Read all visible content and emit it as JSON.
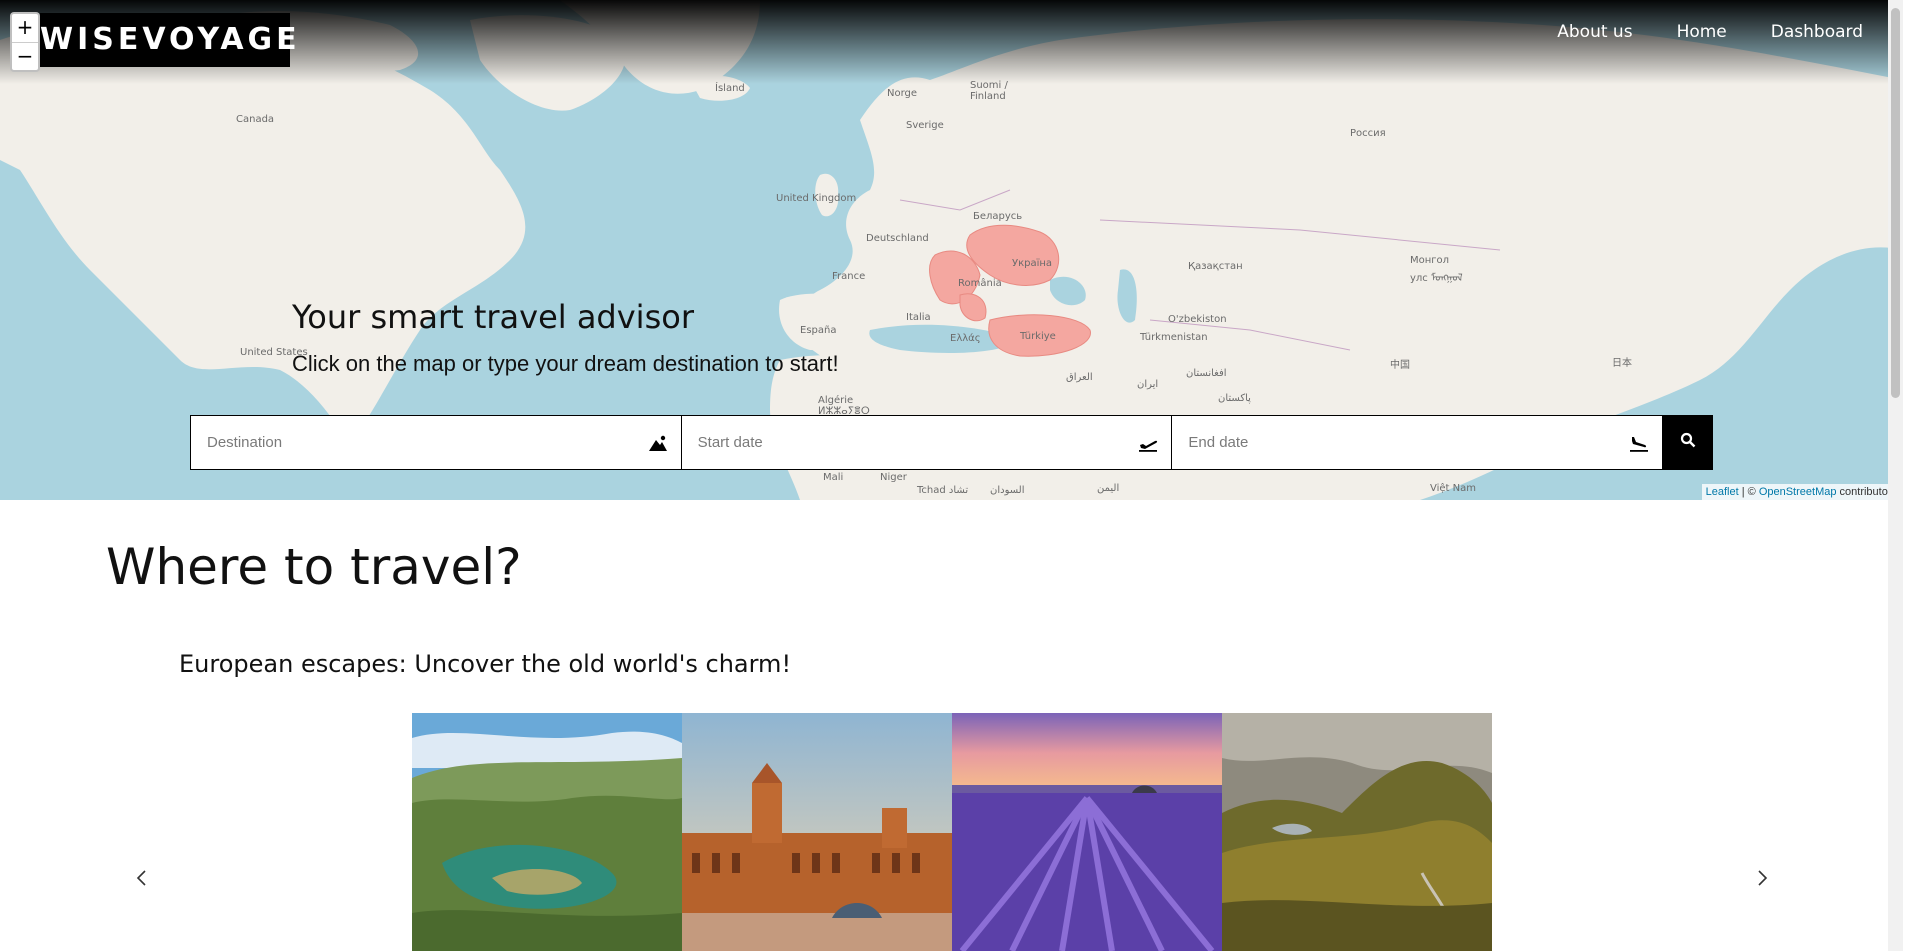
{
  "brand": {
    "logo_text": "WISEVOYAGE"
  },
  "nav": {
    "items": [
      "About us",
      "Home",
      "Dashboard"
    ]
  },
  "map": {
    "zoom_in": "+",
    "zoom_out": "−",
    "highlight_color": "#f4a7a0",
    "labels": [
      {
        "text": "Ísland"
      },
      {
        "text": "Norge"
      },
      {
        "text": "Suomi / Finland"
      },
      {
        "text": "Sverige"
      },
      {
        "text": "Canada"
      },
      {
        "text": "Россия"
      },
      {
        "text": "United Kingdom"
      },
      {
        "text": "Беларусь"
      },
      {
        "text": "Deutschland"
      },
      {
        "text": "Україна"
      },
      {
        "text": "România"
      },
      {
        "text": "France"
      },
      {
        "text": "Italia"
      },
      {
        "text": "España"
      },
      {
        "text": "Ελλάς"
      },
      {
        "text": "Türkiye"
      },
      {
        "text": "Қазақстан"
      },
      {
        "text": "Монгол улс ᠮᠣᠩᠭᠣᠯ"
      },
      {
        "text": "O'zbekiston"
      },
      {
        "text": "Türkmenistan"
      },
      {
        "text": "United States"
      },
      {
        "text": "Algérie ⵍⵣⵣⴰⵢⴻⵔ"
      },
      {
        "text": "العراق"
      },
      {
        "text": "ایران"
      },
      {
        "text": "افغانستان"
      },
      {
        "text": "پاکستان"
      },
      {
        "text": "中国"
      },
      {
        "text": "日本"
      },
      {
        "text": "Mali"
      },
      {
        "text": "Niger"
      },
      {
        "text": "Tchad تشاد"
      },
      {
        "text": "السودان"
      },
      {
        "text": "اليمن"
      },
      {
        "text": "Việt Nam"
      }
    ],
    "attribution": {
      "leaflet": "Leaflet",
      "sep": " | © ",
      "osm": "OpenStreetMap",
      "suffix": " contributors"
    }
  },
  "hero": {
    "title": "Your smart travel advisor",
    "subtitle": "Click on the map or type your dream destination to start!"
  },
  "search": {
    "destination_placeholder": "Destination",
    "start_placeholder": "Start date",
    "end_placeholder": "End date",
    "destination_icon": "mountain-icon",
    "start_icon": "plane-takeoff-icon",
    "end_icon": "plane-landing-icon",
    "submit_icon": "search-icon"
  },
  "section": {
    "title": "Where to travel?",
    "carousel_title": "European escapes: Uncover the old world's charm!",
    "prev_icon": "chevron-left-icon",
    "next_icon": "chevron-right-icon",
    "cards": [
      {
        "name": "river-canyon-image"
      },
      {
        "name": "palace-plaza-image"
      },
      {
        "name": "lavender-field-image"
      },
      {
        "name": "highland-valley-image"
      }
    ]
  }
}
